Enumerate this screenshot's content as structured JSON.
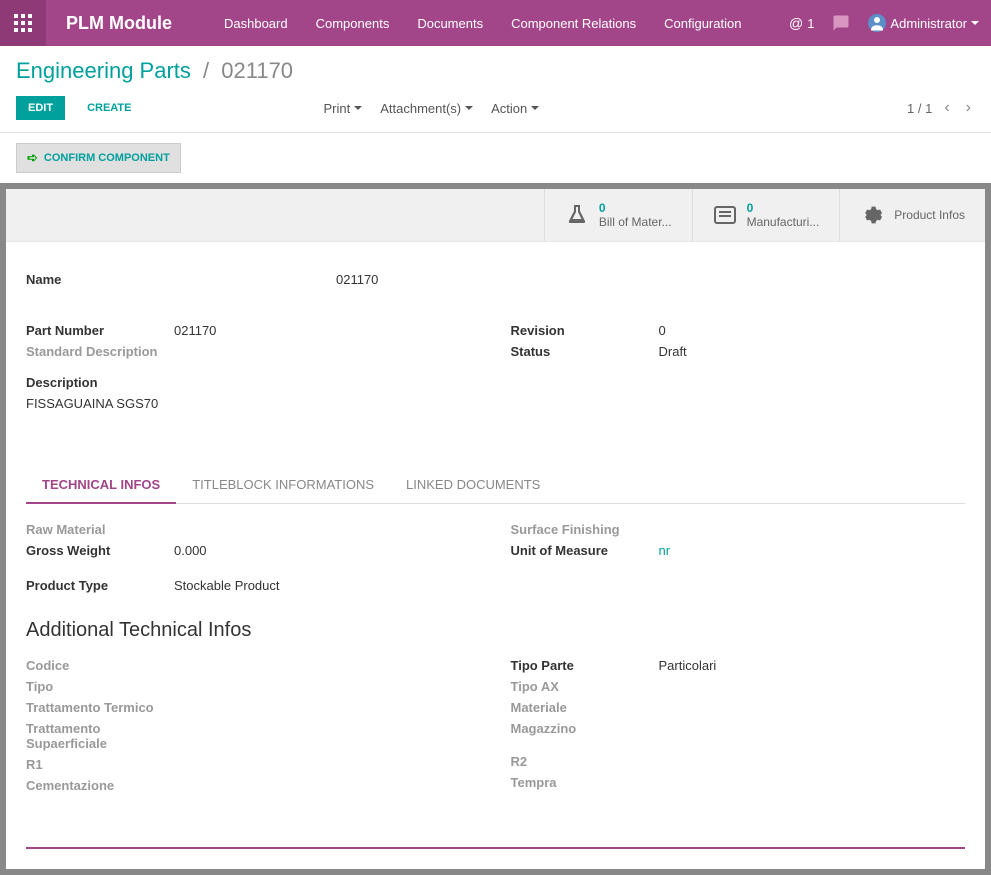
{
  "header": {
    "module_name": "PLM Module",
    "nav": [
      "Dashboard",
      "Components",
      "Documents",
      "Component Relations",
      "Configuration"
    ],
    "msg_count": "1",
    "user": "Administrator"
  },
  "breadcrumb": {
    "parent": "Engineering Parts",
    "current": "021170"
  },
  "actions": {
    "edit": "EDIT",
    "create": "CREATE",
    "print": "Print",
    "attachments": "Attachment(s)",
    "action": "Action",
    "confirm": "CONFIRM COMPONENT",
    "pager": "1 / 1"
  },
  "stats": {
    "bom": {
      "count": "0",
      "label": "Bill of Mater..."
    },
    "manuf": {
      "count": "0",
      "label": "Manufacturi..."
    },
    "prodinfo": {
      "label": "Product Infos"
    }
  },
  "form": {
    "name_label": "Name",
    "name_value": "021170",
    "part_number_label": "Part Number",
    "part_number_value": "021170",
    "std_desc_label": "Standard Description",
    "desc_label": "Description",
    "desc_value": "FISSAGUAINA SGS70",
    "revision_label": "Revision",
    "revision_value": "0",
    "status_label": "Status",
    "status_value": "Draft"
  },
  "tabs": {
    "technical": "TECHNICAL INFOS",
    "titleblock": "TITLEBLOCK INFORMATIONS",
    "linked": "LINKED DOCUMENTS"
  },
  "technical": {
    "raw_material_label": "Raw Material",
    "gross_weight_label": "Gross Weight",
    "gross_weight_value": "0.000",
    "product_type_label": "Product Type",
    "product_type_value": "Stockable Product",
    "surface_finishing_label": "Surface Finishing",
    "uom_label": "Unit of Measure",
    "uom_value": "nr",
    "section_title": "Additional Technical Infos",
    "codice_label": "Codice",
    "tipo_label": "Tipo",
    "trattamento_termico_label": "Trattamento Termico",
    "trattamento_sup_label": "Trattamento Supaerficiale",
    "r1_label": "R1",
    "cementazione_label": "Cementazione",
    "tipo_parte_label": "Tipo Parte",
    "tipo_parte_value": "Particolari",
    "tipo_ax_label": "Tipo AX",
    "materiale_label": "Materiale",
    "magazzino_label": "Magazzino",
    "r2_label": "R2",
    "tempra_label": "Tempra"
  }
}
